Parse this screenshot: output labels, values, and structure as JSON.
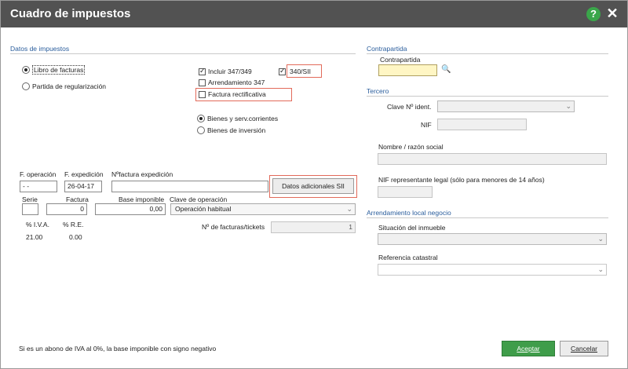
{
  "window": {
    "title": "Cuadro de impuestos"
  },
  "datos": {
    "section_title": "Datos de impuestos",
    "radio_libro": "Libro de facturas",
    "radio_partida": "Partida de regularización",
    "check_347": "Incluir 347/349",
    "check_340": "340/SII",
    "check_arrend": "Arrendamiento 347",
    "check_rect": "Factura rectificativa",
    "radio_bienes": "Bienes y serv.corrientes",
    "radio_inversion": "Bienes de inversión"
  },
  "fields": {
    "f_operacion_label": "F. operación",
    "f_operacion_value": "- -",
    "f_expedicion_label": "F. expedición",
    "f_expedicion_value": "26-04-17",
    "num_factura_label": "Nºfactura expedición",
    "num_factura_value": "",
    "btn_datos_sii": "Datos adicionales SII",
    "serie_label": "Serie",
    "serie_value": "",
    "factura_label": "Factura",
    "factura_value": "0",
    "base_label": "Base imponible",
    "base_value": "0,00",
    "clave_label": "Clave de operación",
    "clave_value": "Operación habitual",
    "iva_label": "% I.V.A.",
    "re_label": "% R.E.",
    "iva_value": "21.00",
    "re_value": "0.00",
    "num_tickets_label": "Nº de facturas/tickets",
    "num_tickets_value": "1"
  },
  "contrapartida": {
    "section_title": "Contrapartida",
    "label": "Contrapartida",
    "value": ""
  },
  "tercero": {
    "section_title": "Tercero",
    "clave_label": "Clave Nº ident.",
    "clave_value": "",
    "nif_label": "NIF",
    "nif_value": "",
    "nombre_label": "Nombre / razón social",
    "nombre_value": "",
    "nif_repr_label": "NIF representante legal (sólo para menores de 14 años)",
    "nif_repr_value": ""
  },
  "arrendamiento": {
    "section_title": "Arrendamiento local negocio",
    "situacion_label": "Situación del inmueble",
    "situacion_value": "",
    "referencia_label": "Referencia catastral",
    "referencia_value": ""
  },
  "footer": {
    "note": "Si es un abono de IVA al 0%, la base imponible con signo negativo",
    "aceptar": "Aceptar",
    "cancelar": "Cancelar"
  },
  "icons": {
    "help": "?",
    "close": "✕",
    "search": "🔍",
    "chevron": "⌄"
  },
  "colors": {
    "titlebar": "#525252",
    "accent_green": "#3f9d4a",
    "section_blue": "#2a5d9c",
    "highlight_red": "#e26a5a"
  }
}
